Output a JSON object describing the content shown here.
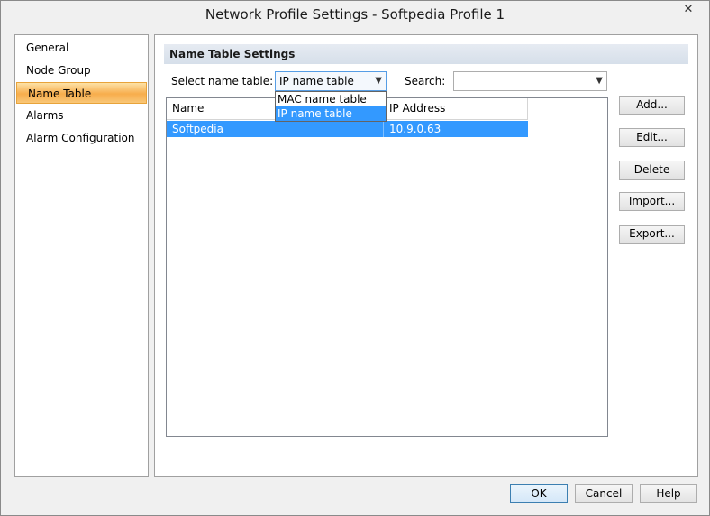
{
  "window": {
    "title": "Network Profile Settings - Softpedia Profile 1",
    "close_glyph": "✕"
  },
  "nav": {
    "items": [
      {
        "label": "General",
        "selected": false
      },
      {
        "label": "Node Group",
        "selected": false
      },
      {
        "label": "Name Table",
        "selected": true
      },
      {
        "label": "Alarms",
        "selected": false
      },
      {
        "label": "Alarm Configuration",
        "selected": false
      }
    ]
  },
  "section": {
    "title": "Name Table Settings"
  },
  "select_table": {
    "label": "Select name table:",
    "value": "IP name table",
    "options": [
      "MAC name table",
      "IP name table"
    ],
    "highlighted_index": 1
  },
  "search": {
    "label": "Search:",
    "value": ""
  },
  "table": {
    "columns": [
      "Name",
      "IP Address"
    ],
    "rows": [
      {
        "name": "Softpedia",
        "ip": "10.9.0.63",
        "selected": true
      }
    ]
  },
  "side_buttons": {
    "add": "Add...",
    "edit": "Edit...",
    "delete": "Delete",
    "import": "Import...",
    "export": "Export..."
  },
  "footer_buttons": {
    "ok": "OK",
    "cancel": "Cancel",
    "help": "Help"
  },
  "colors": {
    "selection": "#3399ff",
    "nav_highlight": "#f7ad4c"
  }
}
